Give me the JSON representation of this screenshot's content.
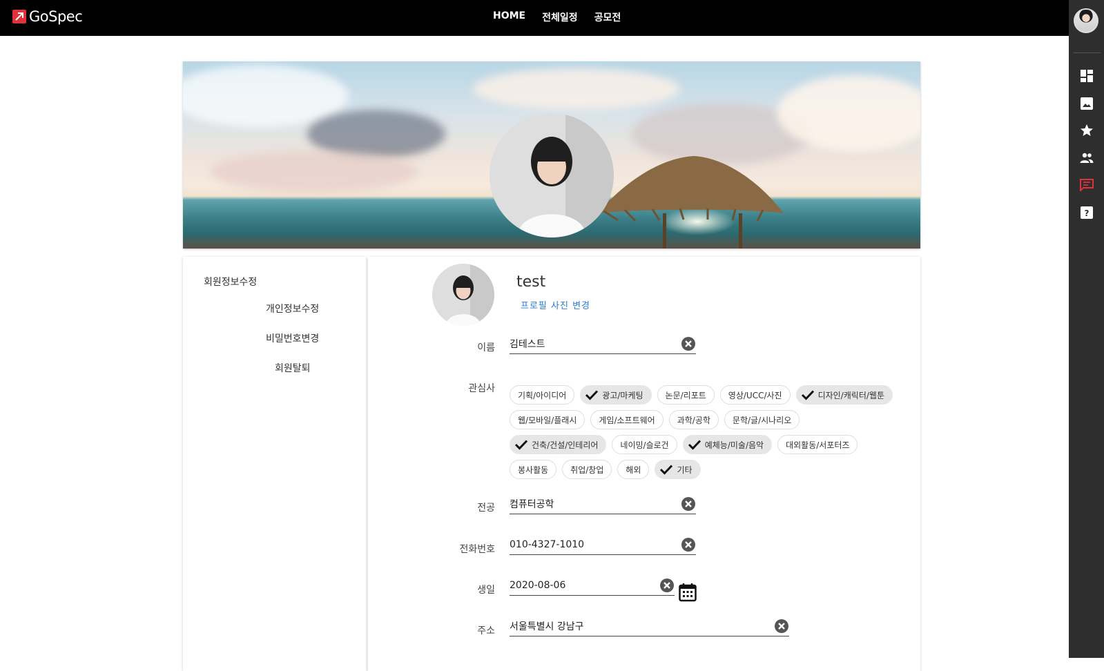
{
  "brand": {
    "name": "GoSpec",
    "accent": "#e0323c"
  },
  "nav": {
    "items": [
      "HOME",
      "전체일정",
      "공모전"
    ]
  },
  "rail": {
    "icons": [
      "dashboard-icon",
      "image-icon",
      "star-icon",
      "people-icon",
      "chat-icon",
      "help-icon"
    ],
    "active_color": "#e0323c"
  },
  "sidebar": {
    "title": "회원정보수정",
    "items": [
      "개인정보수정",
      "비밀번호변경",
      "회원탈퇴"
    ]
  },
  "profile": {
    "name": "test",
    "change_photo": "프로필 사진 변경"
  },
  "form": {
    "name_label": "이름",
    "name_value": "김테스트",
    "interest_label": "관심사",
    "interests": [
      [
        {
          "label": "기획/아이디어",
          "on": false
        },
        {
          "label": "광고/마케팅",
          "on": true
        },
        {
          "label": "논문/리포트",
          "on": false
        },
        {
          "label": "영상/UCC/사진",
          "on": false
        },
        {
          "label": "디자인/캐릭터/웹툰",
          "on": true
        }
      ],
      [
        {
          "label": "웹/모바일/플래시",
          "on": false
        },
        {
          "label": "게임/소프트웨어",
          "on": false
        },
        {
          "label": "과학/공학",
          "on": false
        },
        {
          "label": "문학/글/시나리오",
          "on": false
        }
      ],
      [
        {
          "label": "건축/건설/인테리어",
          "on": true
        },
        {
          "label": "네이밍/슬로건",
          "on": false
        },
        {
          "label": "예체능/미술/음악",
          "on": true
        },
        {
          "label": "대외활동/서포터즈",
          "on": false
        }
      ],
      [
        {
          "label": "봉사활동",
          "on": false
        },
        {
          "label": "취업/창업",
          "on": false
        },
        {
          "label": "해외",
          "on": false
        },
        {
          "label": "기타",
          "on": true
        }
      ]
    ],
    "major_label": "전공",
    "major_value": "컴퓨터공학",
    "phone_label": "전화번호",
    "phone_value": "010-4327-1010",
    "birth_label": "생일",
    "birth_value": "2020-08-06",
    "address_label": "주소",
    "address_value": "서울특별시 강남구"
  }
}
